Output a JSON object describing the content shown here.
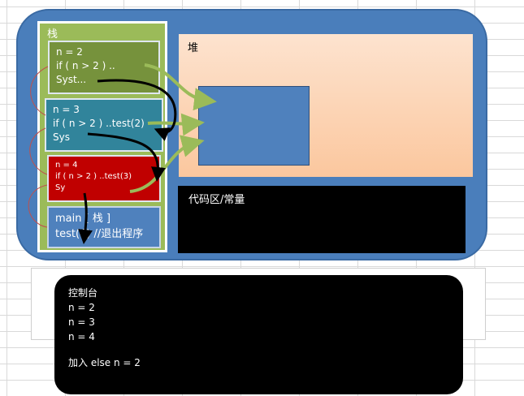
{
  "stack": {
    "title": "栈",
    "frames": [
      {
        "line1": "n  = 2",
        "line2": "if ( n > 2 ) ..",
        "line3": "Syst..."
      },
      {
        "line1": "n  = 3",
        "line2": "if ( n > 2 ) ..test(2)",
        "line3": "Sys"
      },
      {
        "line1": "n   = 4",
        "line2": "if ( n > 2 ) ..test(3)",
        "line3": "Sy"
      }
    ],
    "main": {
      "line1": "main [ 栈 ]",
      "line2": "test(4) //退出程序"
    }
  },
  "heap": {
    "title": "堆"
  },
  "code_area": {
    "title": "代码区/常量"
  },
  "console": {
    "title": "控制台",
    "lines": [
      "n = 2",
      "n = 3",
      "n = 4"
    ],
    "note": "加入 else   n = 2"
  },
  "colors": {
    "memory": "#4a7ebb",
    "stack": "#9bbb59",
    "frame_green": "#76923c",
    "frame_teal": "#31849b",
    "frame_red": "#c00000",
    "frame_blue": "#4f81bd",
    "heap_gradient_top": "#fde3cf",
    "heap_gradient_bottom": "#fbc79e",
    "arrow_green": "#9bbb59"
  }
}
